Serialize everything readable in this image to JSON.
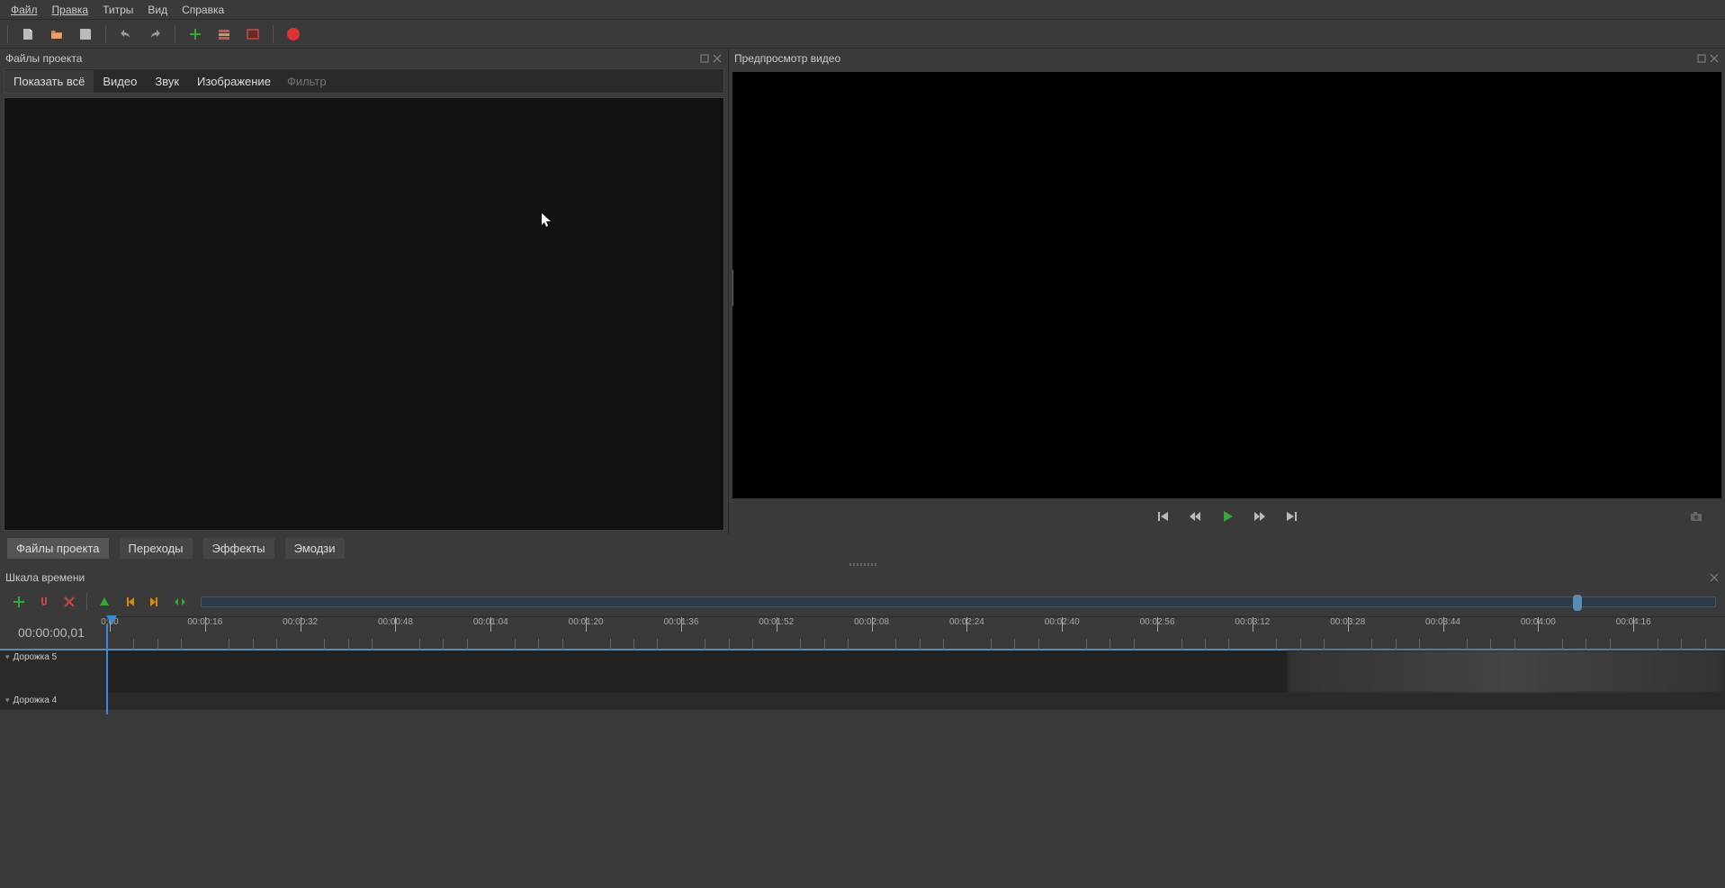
{
  "menu": {
    "file": "Файл",
    "edit": "Правка",
    "titles": "Титры",
    "view": "Вид",
    "help": "Справка"
  },
  "panels": {
    "project_files": "Файлы проекта",
    "video_preview": "Предпросмотр видео",
    "timeline": "Шкала времени"
  },
  "filter_tabs": {
    "show_all": "Показать всё",
    "video": "Видео",
    "audio": "Звук",
    "image": "Изображение",
    "filter_placeholder": "Фильтр"
  },
  "bottom_tabs": {
    "project_files": "Файлы проекта",
    "transitions": "Переходы",
    "effects": "Эффекты",
    "emoji": "Эмодзи"
  },
  "timeline": {
    "current_time": "00:00:00,01",
    "ruler": [
      "0:00",
      "00:00:16",
      "00:00:32",
      "00:00:48",
      "00:01:04",
      "00:01:20",
      "00:01:36",
      "00:01:52",
      "00:02:08",
      "00:02:24",
      "00:02:40",
      "00:02:56",
      "00:03:12",
      "00:03:28",
      "00:03:44",
      "00:04:00",
      "00:04:16"
    ],
    "tracks": [
      {
        "name": "Дорожка 5"
      },
      {
        "name": "Дорожка 4"
      }
    ]
  }
}
